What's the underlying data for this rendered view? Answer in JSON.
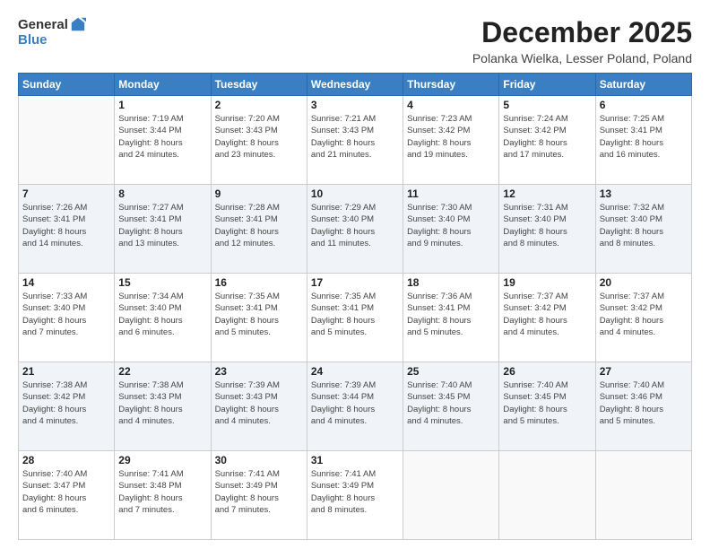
{
  "header": {
    "logo_general": "General",
    "logo_blue": "Blue",
    "month_title": "December 2025",
    "subtitle": "Polanka Wielka, Lesser Poland, Poland"
  },
  "days_of_week": [
    "Sunday",
    "Monday",
    "Tuesday",
    "Wednesday",
    "Thursday",
    "Friday",
    "Saturday"
  ],
  "weeks": [
    [
      {
        "day": "",
        "info": ""
      },
      {
        "day": "1",
        "info": "Sunrise: 7:19 AM\nSunset: 3:44 PM\nDaylight: 8 hours\nand 24 minutes."
      },
      {
        "day": "2",
        "info": "Sunrise: 7:20 AM\nSunset: 3:43 PM\nDaylight: 8 hours\nand 23 minutes."
      },
      {
        "day": "3",
        "info": "Sunrise: 7:21 AM\nSunset: 3:43 PM\nDaylight: 8 hours\nand 21 minutes."
      },
      {
        "day": "4",
        "info": "Sunrise: 7:23 AM\nSunset: 3:42 PM\nDaylight: 8 hours\nand 19 minutes."
      },
      {
        "day": "5",
        "info": "Sunrise: 7:24 AM\nSunset: 3:42 PM\nDaylight: 8 hours\nand 17 minutes."
      },
      {
        "day": "6",
        "info": "Sunrise: 7:25 AM\nSunset: 3:41 PM\nDaylight: 8 hours\nand 16 minutes."
      }
    ],
    [
      {
        "day": "7",
        "info": "Sunrise: 7:26 AM\nSunset: 3:41 PM\nDaylight: 8 hours\nand 14 minutes."
      },
      {
        "day": "8",
        "info": "Sunrise: 7:27 AM\nSunset: 3:41 PM\nDaylight: 8 hours\nand 13 minutes."
      },
      {
        "day": "9",
        "info": "Sunrise: 7:28 AM\nSunset: 3:41 PM\nDaylight: 8 hours\nand 12 minutes."
      },
      {
        "day": "10",
        "info": "Sunrise: 7:29 AM\nSunset: 3:40 PM\nDaylight: 8 hours\nand 11 minutes."
      },
      {
        "day": "11",
        "info": "Sunrise: 7:30 AM\nSunset: 3:40 PM\nDaylight: 8 hours\nand 9 minutes."
      },
      {
        "day": "12",
        "info": "Sunrise: 7:31 AM\nSunset: 3:40 PM\nDaylight: 8 hours\nand 8 minutes."
      },
      {
        "day": "13",
        "info": "Sunrise: 7:32 AM\nSunset: 3:40 PM\nDaylight: 8 hours\nand 8 minutes."
      }
    ],
    [
      {
        "day": "14",
        "info": "Sunrise: 7:33 AM\nSunset: 3:40 PM\nDaylight: 8 hours\nand 7 minutes."
      },
      {
        "day": "15",
        "info": "Sunrise: 7:34 AM\nSunset: 3:40 PM\nDaylight: 8 hours\nand 6 minutes."
      },
      {
        "day": "16",
        "info": "Sunrise: 7:35 AM\nSunset: 3:41 PM\nDaylight: 8 hours\nand 5 minutes."
      },
      {
        "day": "17",
        "info": "Sunrise: 7:35 AM\nSunset: 3:41 PM\nDaylight: 8 hours\nand 5 minutes."
      },
      {
        "day": "18",
        "info": "Sunrise: 7:36 AM\nSunset: 3:41 PM\nDaylight: 8 hours\nand 5 minutes."
      },
      {
        "day": "19",
        "info": "Sunrise: 7:37 AM\nSunset: 3:42 PM\nDaylight: 8 hours\nand 4 minutes."
      },
      {
        "day": "20",
        "info": "Sunrise: 7:37 AM\nSunset: 3:42 PM\nDaylight: 8 hours\nand 4 minutes."
      }
    ],
    [
      {
        "day": "21",
        "info": "Sunrise: 7:38 AM\nSunset: 3:42 PM\nDaylight: 8 hours\nand 4 minutes."
      },
      {
        "day": "22",
        "info": "Sunrise: 7:38 AM\nSunset: 3:43 PM\nDaylight: 8 hours\nand 4 minutes."
      },
      {
        "day": "23",
        "info": "Sunrise: 7:39 AM\nSunset: 3:43 PM\nDaylight: 8 hours\nand 4 minutes."
      },
      {
        "day": "24",
        "info": "Sunrise: 7:39 AM\nSunset: 3:44 PM\nDaylight: 8 hours\nand 4 minutes."
      },
      {
        "day": "25",
        "info": "Sunrise: 7:40 AM\nSunset: 3:45 PM\nDaylight: 8 hours\nand 4 minutes."
      },
      {
        "day": "26",
        "info": "Sunrise: 7:40 AM\nSunset: 3:45 PM\nDaylight: 8 hours\nand 5 minutes."
      },
      {
        "day": "27",
        "info": "Sunrise: 7:40 AM\nSunset: 3:46 PM\nDaylight: 8 hours\nand 5 minutes."
      }
    ],
    [
      {
        "day": "28",
        "info": "Sunrise: 7:40 AM\nSunset: 3:47 PM\nDaylight: 8 hours\nand 6 minutes."
      },
      {
        "day": "29",
        "info": "Sunrise: 7:41 AM\nSunset: 3:48 PM\nDaylight: 8 hours\nand 7 minutes."
      },
      {
        "day": "30",
        "info": "Sunrise: 7:41 AM\nSunset: 3:49 PM\nDaylight: 8 hours\nand 7 minutes."
      },
      {
        "day": "31",
        "info": "Sunrise: 7:41 AM\nSunset: 3:49 PM\nDaylight: 8 hours\nand 8 minutes."
      },
      {
        "day": "",
        "info": ""
      },
      {
        "day": "",
        "info": ""
      },
      {
        "day": "",
        "info": ""
      }
    ]
  ]
}
